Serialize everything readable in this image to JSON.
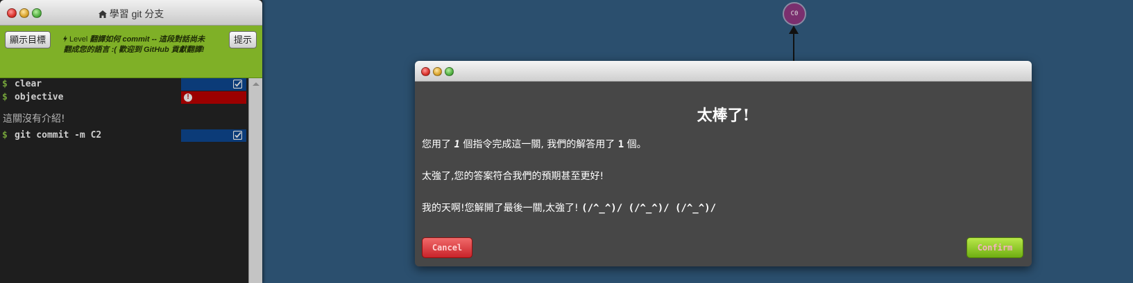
{
  "terminal_window": {
    "title": "學習 git 分支",
    "title_icon": "home-icon",
    "goal_button": "顯示目標",
    "hint_button": "提示",
    "level_prefix": "Level",
    "level_text": "翻譯如何 commit -- 這段對話尚未翻成您的語言 :( 歡迎到 GitHub 貢獻翻譯!",
    "lines": [
      {
        "prompt": "$",
        "command": "clear",
        "status": "success"
      },
      {
        "prompt": "$",
        "command": "objective",
        "status": "error"
      },
      {
        "prompt": "$",
        "command": "git commit -m C2",
        "status": "success"
      }
    ],
    "info_text": "這關沒有介紹!"
  },
  "visualization": {
    "node_label": "C0"
  },
  "modal": {
    "title": "太棒了!",
    "line1_a": "您用了",
    "line1_n1": "1",
    "line1_b": "個指令完成這一關,  我們的解答用了",
    "line1_n2": "1",
    "line1_c": "個。",
    "line2": "太強了,您的答案符合我們的預期甚至更好!",
    "line3_a": "我的天啊!您解開了最後一關,太強了!",
    "line3_b": "(/^_^)/ (/^_^)/ (/^_^)/",
    "cancel_label": "Cancel",
    "confirm_label": "Confirm"
  },
  "colors": {
    "background": "#2b4f6e",
    "header_green": "#7fb027",
    "success_blue": "#0b3b78",
    "error_red": "#9b0000",
    "node_purple": "#7a2f6e"
  }
}
